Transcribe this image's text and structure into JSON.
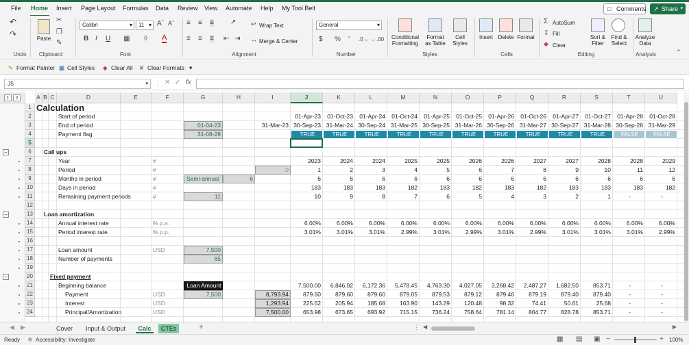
{
  "menu": [
    "File",
    "Home",
    "Insert",
    "Page Layout",
    "Formulas",
    "Data",
    "Review",
    "View",
    "Automate",
    "Help",
    "My Tool Belt"
  ],
  "comments_label": "Comments",
  "share_label": "Share",
  "ribbon": {
    "font_name": "Calibri",
    "font_size": "11",
    "number_format": "General",
    "paste": "Paste",
    "wrap_text": "Wrap Text",
    "merge_center": "Merge & Center",
    "conditional_formatting": "Conditional Formatting",
    "format_as_table": "Format as Table",
    "cell_styles": "Cell Styles",
    "insert": "Insert",
    "delete": "Delete",
    "format": "Format",
    "autosum": "AutoSum",
    "fill": "Fill",
    "clear": "Clear",
    "sort_filter": "Sort & Filter",
    "find_select": "Find & Select",
    "analyze_data": "Analyze Data",
    "groups": {
      "undo": "Undo",
      "clipboard": "Clipboard",
      "font": "Font",
      "alignment": "Alignment",
      "number": "Number",
      "styles": "Styles",
      "cells": "Cells",
      "editing": "Editing",
      "analysis": "Analysis"
    }
  },
  "quickbar": {
    "format_painter": "Format Painter",
    "cell_styles": "Cell Styles",
    "clear_all": "Clear All",
    "clear_formats": "Clear Formats"
  },
  "name_box": "J5",
  "columns": [
    "A",
    "B",
    "C",
    "D",
    "E",
    "F",
    "G",
    "H",
    "I",
    "J",
    "K",
    "L",
    "M",
    "N",
    "O",
    "P",
    "Q",
    "R",
    "S",
    "T",
    "U"
  ],
  "outline_levels": [
    "1",
    "2"
  ],
  "rows": [
    "1",
    "2",
    "3",
    "4",
    "5",
    "6",
    "7",
    "8",
    "9",
    "10",
    "11",
    "12",
    "13",
    "14",
    "15",
    "16",
    "17",
    "18",
    "19",
    "20",
    "21",
    "22",
    "23",
    "24"
  ],
  "labels": {
    "title": "Calculation",
    "start_period": "Start of period",
    "end_period": "End of period",
    "payment_flag": "Payment flag",
    "call_ups": "Call ups",
    "year": "Year",
    "period": "Period",
    "months_in_period": "Months in period",
    "days_in_period": "Days in period",
    "remaining_periods": "Remaining payment periods",
    "loan_amort": "Loan amortization",
    "annual_rate": "Annual interest rate",
    "period_rate": "Period interest rate",
    "loan_amount": "Loan amount",
    "num_payments": "Number of payments",
    "fixed_payment": "Fixed payment",
    "beginning_balance": "Beginning balance",
    "payment": "Payment",
    "interest": "Interest",
    "principal": "Principal/Amortization"
  },
  "units": {
    "hash": "#",
    "pa": "% p.a.",
    "pp": "% p.p.",
    "usd": "USD"
  },
  "inputs": {
    "g3": "01-04-23",
    "g4": "31-08-28",
    "i3": "31-Mar-23",
    "i8": "0",
    "g9": "Semi-annual",
    "h9": "6",
    "g11": "11",
    "g17": "7,500",
    "g18": "65",
    "g21": "Loan Amount",
    "g22": "7,500",
    "i22": "8,793.94",
    "i23": "1,293.94",
    "i24": "7,500.00"
  },
  "timeline": {
    "start": [
      "01-Apr-23",
      "01-Oct-23",
      "01-Apr-24",
      "01-Oct-24",
      "01-Apr-25",
      "01-Oct-25",
      "01-Apr-26",
      "01-Oct-26",
      "01-Apr-27",
      "01-Oct-27",
      "01-Apr-28",
      "01-Oct-28"
    ],
    "end": [
      "30-Sep-23",
      "31-Mar-24",
      "30-Sep-24",
      "31-Mar-25",
      "30-Sep-25",
      "31-Mar-26",
      "30-Sep-26",
      "31-Mar-27",
      "30-Sep-27",
      "31-Mar-28",
      "30-Sep-28",
      "31-Mar-29"
    ],
    "flag": [
      "TRUE",
      "TRUE",
      "TRUE",
      "TRUE",
      "TRUE",
      "TRUE",
      "TRUE",
      "TRUE",
      "TRUE",
      "TRUE",
      "FALSE",
      "FALSE"
    ],
    "year": [
      "2023",
      "2024",
      "2024",
      "2025",
      "2025",
      "2026",
      "2026",
      "2027",
      "2027",
      "2028",
      "2028",
      "2029"
    ],
    "period": [
      "1",
      "2",
      "3",
      "4",
      "5",
      "6",
      "7",
      "8",
      "9",
      "10",
      "11",
      "12"
    ],
    "months": [
      "6",
      "6",
      "6",
      "6",
      "6",
      "6",
      "6",
      "6",
      "6",
      "6",
      "6",
      "6"
    ],
    "days": [
      "183",
      "183",
      "183",
      "182",
      "183",
      "182",
      "183",
      "182",
      "183",
      "183",
      "183",
      "182"
    ],
    "remaining": [
      "10",
      "9",
      "8",
      "7",
      "6",
      "5",
      "4",
      "3",
      "2",
      "1",
      "-",
      "-"
    ],
    "annual_rate": [
      "6.00%",
      "6.00%",
      "6.00%",
      "6.00%",
      "6.00%",
      "6.00%",
      "6.00%",
      "6.00%",
      "6.00%",
      "6.00%",
      "6.00%",
      "6.00%"
    ],
    "period_rate": [
      "3.01%",
      "3.01%",
      "3.01%",
      "2.99%",
      "3.01%",
      "2.99%",
      "3.01%",
      "2.99%",
      "3.01%",
      "3.01%",
      "3.01%",
      "2.99%"
    ],
    "beginning": [
      "7,500.00",
      "6,846.02",
      "6,172.36",
      "5,478.45",
      "4,763.30",
      "4,027.05",
      "3,268.42",
      "2,487.27",
      "1,682.50",
      "853.71",
      "-",
      "-"
    ],
    "payment": [
      "879.60",
      "879.60",
      "879.60",
      "879.05",
      "879.53",
      "879.12",
      "879.46",
      "879.19",
      "879.40",
      "879.40",
      "-",
      "-"
    ],
    "interest": [
      "225.62",
      "205.94",
      "185.68",
      "163.90",
      "143.29",
      "120.48",
      "98.32",
      "74.41",
      "50.61",
      "25.68",
      "-",
      "-"
    ],
    "principal": [
      "653.98",
      "673.65",
      "693.92",
      "715.15",
      "736.24",
      "758.64",
      "781.14",
      "804.77",
      "828.78",
      "853.71",
      "-",
      "-"
    ]
  },
  "sheets": [
    "Cover",
    "Input & Output",
    "Calc",
    "CTEs"
  ],
  "active_sheet": "Calc",
  "status": {
    "ready": "Ready",
    "accessibility": "Accessibility: Investigate",
    "zoom": "100%"
  },
  "colors": {
    "accent": "#1e7145",
    "flag_true": "#1f8aa5",
    "flag_false": "#a9c4d3",
    "input_fill": "#d9d9d9",
    "dark_header": "#1a1a1a"
  }
}
